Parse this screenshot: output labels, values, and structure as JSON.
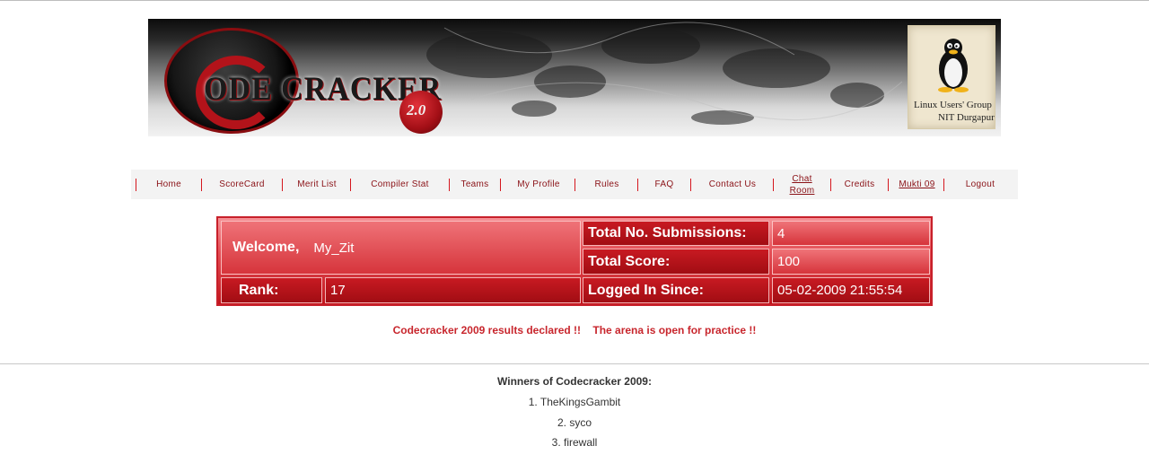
{
  "banner": {
    "logo_text": "ODE CRACKER",
    "version": "2.0",
    "lug_line1": "Linux Users' Group",
    "lug_line2": "NIT Durgapur"
  },
  "nav": [
    {
      "label": "Home"
    },
    {
      "label": "ScoreCard"
    },
    {
      "label": "Merit List"
    },
    {
      "label": "Compiler Stat"
    },
    {
      "label": "Teams"
    },
    {
      "label": "My Profile"
    },
    {
      "label": "Rules"
    },
    {
      "label": "FAQ"
    },
    {
      "label": "Contact Us"
    },
    {
      "label": "Chat\nRoom"
    },
    {
      "label": "Credits"
    },
    {
      "label": "Mukti 09"
    },
    {
      "label": "Logout"
    }
  ],
  "info": {
    "welcome_label": "Welcome,",
    "username": "My_Zit",
    "submissions_label": "Total No. Submissions:",
    "submissions_value": "4",
    "score_label": "Total Score:",
    "score_value": "100",
    "rank_label": "Rank:",
    "rank_value": "17",
    "logged_label": "Logged In Since:",
    "logged_value": "05-02-2009 21:55:54"
  },
  "announcement": "Codecracker 2009 results declared !!    The arena is open for practice !!",
  "winners": {
    "title": "Winners of Codecracker 2009:",
    "list": [
      "1. TheKingsGambit",
      "2. syco",
      "3. firewall"
    ]
  },
  "colors": {
    "accent_red": "#c8262d",
    "nav_text": "#8a1116",
    "table_dark": "#a10d13"
  }
}
